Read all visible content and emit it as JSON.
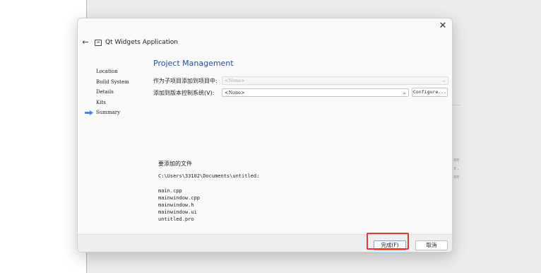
{
  "background": {
    "side_text": [
      "on",
      "s.",
      "on"
    ]
  },
  "dialog": {
    "window_title": "Qt Widgets Application",
    "close_glyph": "✕",
    "back_glyph": "←",
    "icons": {
      "back": "arrow-left-icon",
      "app": "window-icon",
      "current_step": "arrow-right-icon"
    },
    "steps": [
      "Location",
      "Build System",
      "Details",
      "Kits",
      "Summary"
    ],
    "current_step": "Summary",
    "page_title": "Project Management",
    "subproject": {
      "label": "作为子项目添加到项目中:",
      "value": "<None>",
      "enabled": false
    },
    "vcs": {
      "label": "添加到版本控制系统(V):",
      "value": "<None>",
      "configure_label": "Configure..."
    },
    "files_heading": "要添加的文件",
    "files_path": "C:\\Users\\33102\\Documents\\untitled:",
    "files": [
      "main.cpp",
      "mainwindow.cpp",
      "mainwindow.h",
      "mainwindow.ui",
      "untitled.pro"
    ],
    "buttons": {
      "finish": "完成(F)",
      "cancel": "取消"
    },
    "colors": {
      "title": "#1f4d9a",
      "highlight": "#e4353a",
      "arrow": "#4a86e8"
    }
  }
}
